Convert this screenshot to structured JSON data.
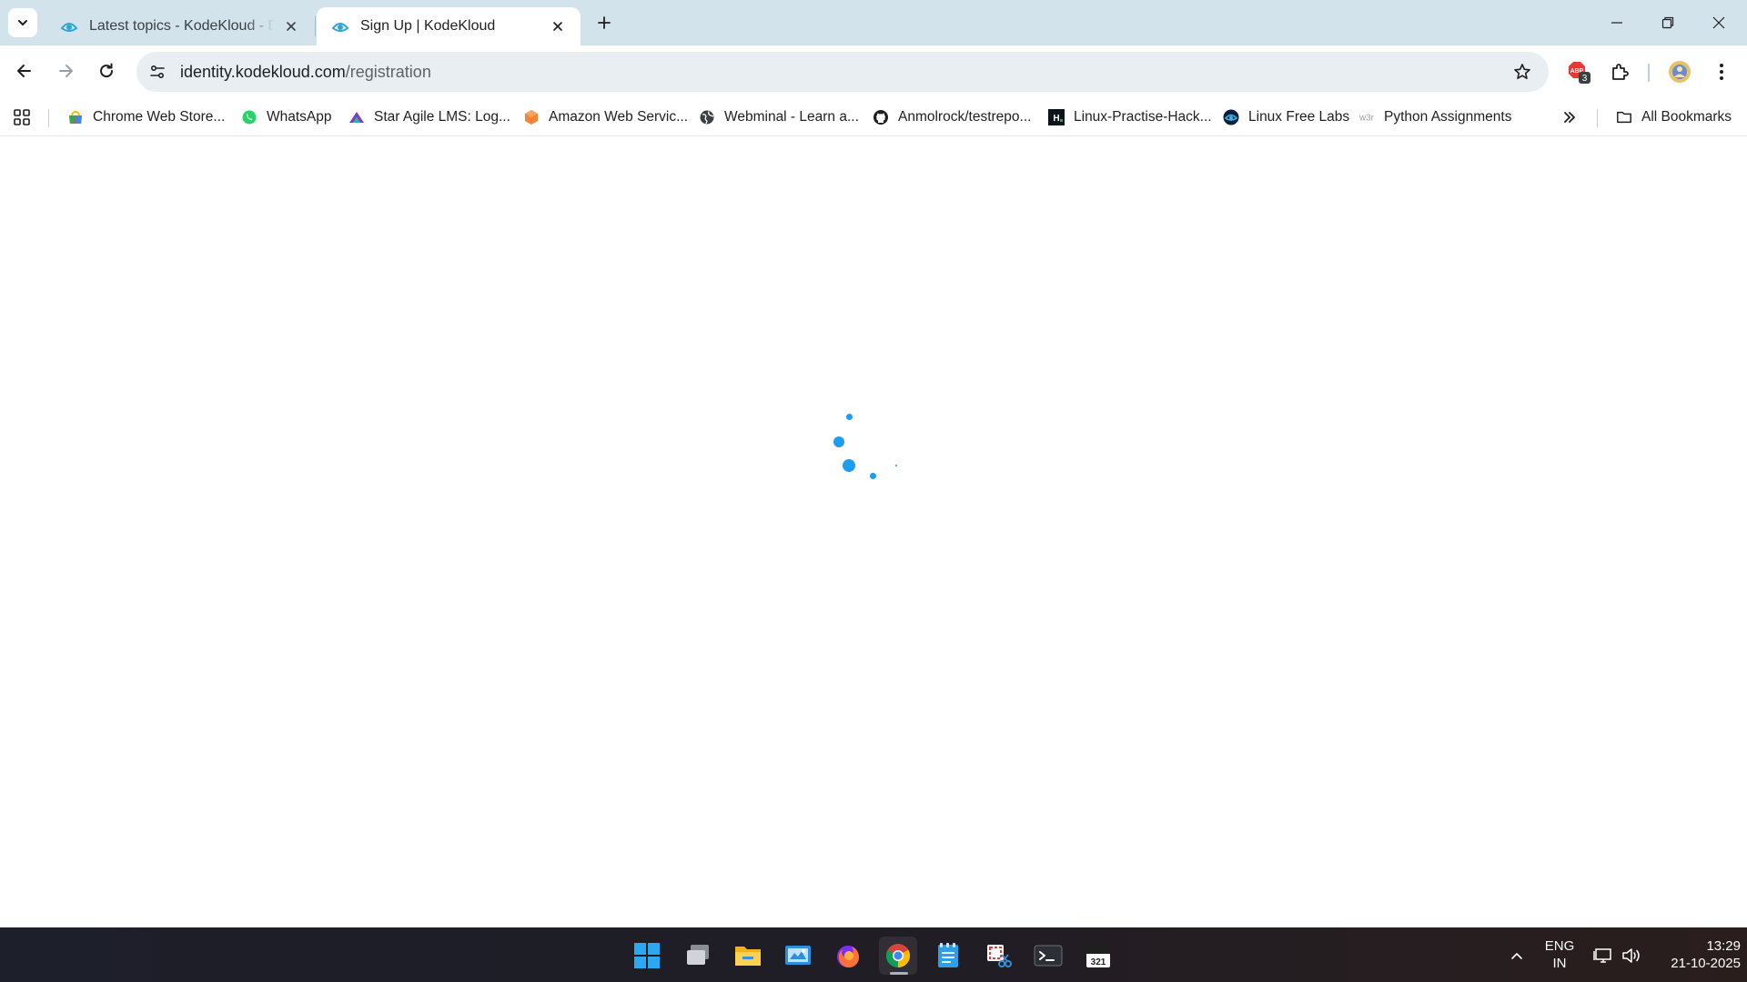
{
  "browser": {
    "tabs": [
      {
        "title": "Latest topics - KodeKloud - DevOps",
        "active": false
      },
      {
        "title": "Sign Up | KodeKloud",
        "active": true
      }
    ],
    "address": {
      "host": "identity.kodekloud.com",
      "path": "/registration"
    },
    "extensions_badge": "3"
  },
  "bookmarks": {
    "items": [
      {
        "label": "Chrome Web Store...",
        "icon": "chrome-web-store-icon"
      },
      {
        "label": "WhatsApp",
        "icon": "whatsapp-icon"
      },
      {
        "label": "Star Agile LMS: Log...",
        "icon": "star-agile-icon"
      },
      {
        "label": "Amazon Web Servic...",
        "icon": "aws-icon"
      },
      {
        "label": "Webminal - Learn a...",
        "icon": "globe-icon"
      },
      {
        "label": "Anmolrock/testrepo...",
        "icon": "github-icon"
      },
      {
        "label": "Linux-Practise-Hack...",
        "icon": "hackerrank-icon"
      },
      {
        "label": "Linux Free Labs",
        "icon": "kodekloud-icon"
      },
      {
        "label": "Python Assignments",
        "icon": "w3schools-icon"
      }
    ],
    "all_bookmarks": "All Bookmarks"
  },
  "colors": {
    "tabstrip": "#d2e3ec",
    "spinner": "#1e9cef",
    "taskbar": "#1e1f28"
  },
  "taskbar": {
    "apps": [
      "start-icon",
      "task-view-icon",
      "file-explorer-icon",
      "control-panel-icon",
      "firefox-icon",
      "chrome-icon",
      "notepad-icon",
      "snipping-tool-icon",
      "terminal-icon",
      "media-player-icon"
    ],
    "language": {
      "line1": "ENG",
      "line2": "IN"
    },
    "clock": {
      "time": "13:29",
      "date": "21-10-2025"
    }
  }
}
